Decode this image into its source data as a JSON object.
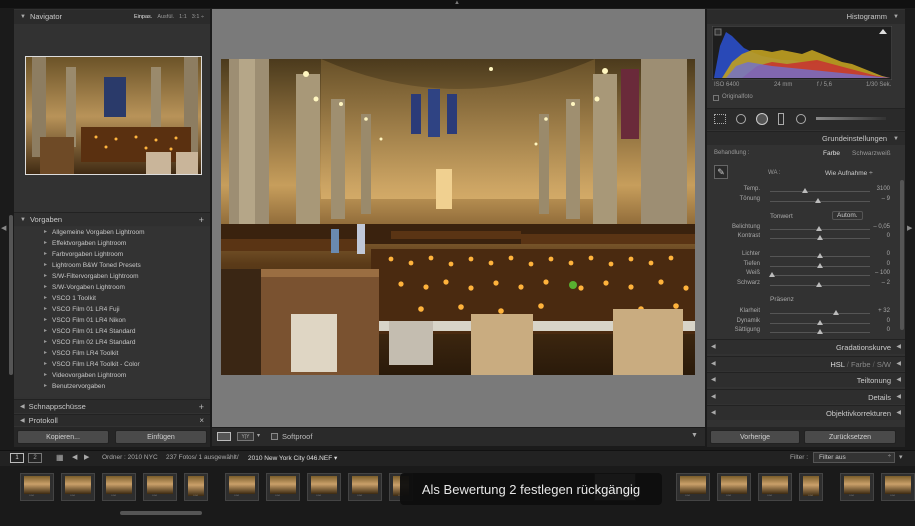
{
  "navigator": {
    "title": "Navigator",
    "zoom_options": [
      "Einpas.",
      "Ausfül.",
      "1:1",
      "3:1 ÷"
    ]
  },
  "presets": {
    "title": "Vorgaben",
    "items": [
      "Allgemeine Vorgaben Lightroom",
      "Effektvorgaben Lightroom",
      "Farbvorgaben Lightroom",
      "Lightroom B&W Toned Presets",
      "S/W-Filtervorgaben Lightroom",
      "S/W-Vorgaben Lightroom",
      "VSCO 1 Toolkit",
      "VSCO Film 01 LR4 Fuji",
      "VSCO Film 01 LR4 Nikon",
      "VSCO Film 01 LR4 Standard",
      "VSCO Film 02 LR4 Standard",
      "VSCO Film LR4 Toolkit",
      "VSCO Film LR4 Toolkit - Color",
      "Videovorgaben Lightroom",
      "Benutzervorgaben"
    ]
  },
  "snapshots": {
    "title": "Schnappschüsse"
  },
  "history": {
    "title": "Protokoll"
  },
  "left_buttons": {
    "copy": "Kopieren...",
    "paste": "Einfügen"
  },
  "toolbar": {
    "softproof": "Softproof"
  },
  "histogram": {
    "title": "Histogramm",
    "iso": "ISO 6400",
    "focal": "24 mm",
    "aperture": "f / 5,6",
    "shutter": "1/30 Sek.",
    "original": "Originalfoto"
  },
  "basic": {
    "title": "Grundeinstellungen",
    "treatment_label": "Behandlung :",
    "treatment_color": "Farbe",
    "treatment_bw": "Schwarzweiß",
    "wb_label": "WA :",
    "wb_value": "Wie Aufnahme ÷",
    "tone_label": "Tonwert",
    "auto": "Autom.",
    "presence_label": "Präsenz",
    "sliders": [
      {
        "label": "Temp.",
        "value": "3100",
        "pos": 0.35
      },
      {
        "label": "Tönung",
        "value": "– 9",
        "pos": 0.48
      },
      {
        "label": "Belichtung",
        "value": "– 0,05",
        "pos": 0.49
      },
      {
        "label": "Kontrast",
        "value": "0",
        "pos": 0.5
      },
      {
        "label": "Lichter",
        "value": "0",
        "pos": 0.5
      },
      {
        "label": "Tiefen",
        "value": "0",
        "pos": 0.5
      },
      {
        "label": "Weiß",
        "value": "– 100",
        "pos": 0.02
      },
      {
        "label": "Schwarz",
        "value": "– 2",
        "pos": 0.49
      },
      {
        "label": "Klarheit",
        "value": "+ 32",
        "pos": 0.66
      },
      {
        "label": "Dynamik",
        "value": "0",
        "pos": 0.5
      },
      {
        "label": "Sättigung",
        "value": "0",
        "pos": 0.5
      }
    ]
  },
  "collapsed_panels": {
    "tone_curve": "Gradationskurve",
    "hsl_a": "HSL",
    "hsl_b": "Farbe",
    "hsl_c": "S/W",
    "detail_split": "Teiltonung",
    "details": "Details",
    "lens": "Objektivkorrekturen"
  },
  "right_buttons": {
    "previous": "Vorherige",
    "reset": "Zurücksetzen"
  },
  "filmstrip": {
    "screen1": "1",
    "screen2": "2",
    "folder": "Ordner : 2010 NYC",
    "count": "237 Fotos/ 1 ausgewählt/",
    "filename": "2010 New York City 046.NEF ▾",
    "filter_label": "Filter :",
    "filter_value": "Filter aus"
  },
  "tooltip": "Als Bewertung 2 festlegen rückgängig",
  "colors": {
    "accent": "#dcdcdc",
    "panel": "#333333",
    "bg": "#1b1b1b"
  }
}
